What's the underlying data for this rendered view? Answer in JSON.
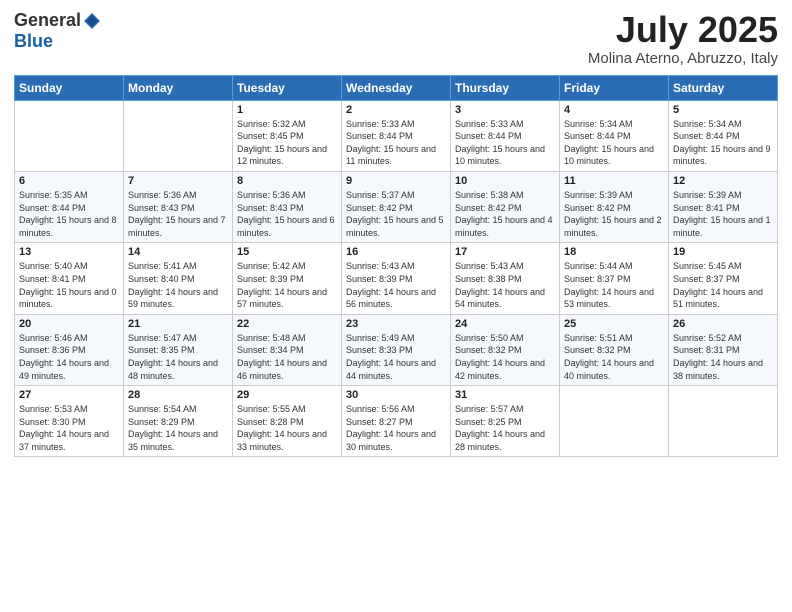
{
  "logo": {
    "general": "General",
    "blue": "Blue"
  },
  "title": "July 2025",
  "location": "Molina Aterno, Abruzzo, Italy",
  "weekdays": [
    "Sunday",
    "Monday",
    "Tuesday",
    "Wednesday",
    "Thursday",
    "Friday",
    "Saturday"
  ],
  "weeks": [
    [
      {
        "day": "",
        "info": ""
      },
      {
        "day": "",
        "info": ""
      },
      {
        "day": "1",
        "info": "Sunrise: 5:32 AM\nSunset: 8:45 PM\nDaylight: 15 hours and 12 minutes."
      },
      {
        "day": "2",
        "info": "Sunrise: 5:33 AM\nSunset: 8:44 PM\nDaylight: 15 hours and 11 minutes."
      },
      {
        "day": "3",
        "info": "Sunrise: 5:33 AM\nSunset: 8:44 PM\nDaylight: 15 hours and 10 minutes."
      },
      {
        "day": "4",
        "info": "Sunrise: 5:34 AM\nSunset: 8:44 PM\nDaylight: 15 hours and 10 minutes."
      },
      {
        "day": "5",
        "info": "Sunrise: 5:34 AM\nSunset: 8:44 PM\nDaylight: 15 hours and 9 minutes."
      }
    ],
    [
      {
        "day": "6",
        "info": "Sunrise: 5:35 AM\nSunset: 8:44 PM\nDaylight: 15 hours and 8 minutes."
      },
      {
        "day": "7",
        "info": "Sunrise: 5:36 AM\nSunset: 8:43 PM\nDaylight: 15 hours and 7 minutes."
      },
      {
        "day": "8",
        "info": "Sunrise: 5:36 AM\nSunset: 8:43 PM\nDaylight: 15 hours and 6 minutes."
      },
      {
        "day": "9",
        "info": "Sunrise: 5:37 AM\nSunset: 8:42 PM\nDaylight: 15 hours and 5 minutes."
      },
      {
        "day": "10",
        "info": "Sunrise: 5:38 AM\nSunset: 8:42 PM\nDaylight: 15 hours and 4 minutes."
      },
      {
        "day": "11",
        "info": "Sunrise: 5:39 AM\nSunset: 8:42 PM\nDaylight: 15 hours and 2 minutes."
      },
      {
        "day": "12",
        "info": "Sunrise: 5:39 AM\nSunset: 8:41 PM\nDaylight: 15 hours and 1 minute."
      }
    ],
    [
      {
        "day": "13",
        "info": "Sunrise: 5:40 AM\nSunset: 8:41 PM\nDaylight: 15 hours and 0 minutes."
      },
      {
        "day": "14",
        "info": "Sunrise: 5:41 AM\nSunset: 8:40 PM\nDaylight: 14 hours and 59 minutes."
      },
      {
        "day": "15",
        "info": "Sunrise: 5:42 AM\nSunset: 8:39 PM\nDaylight: 14 hours and 57 minutes."
      },
      {
        "day": "16",
        "info": "Sunrise: 5:43 AM\nSunset: 8:39 PM\nDaylight: 14 hours and 56 minutes."
      },
      {
        "day": "17",
        "info": "Sunrise: 5:43 AM\nSunset: 8:38 PM\nDaylight: 14 hours and 54 minutes."
      },
      {
        "day": "18",
        "info": "Sunrise: 5:44 AM\nSunset: 8:37 PM\nDaylight: 14 hours and 53 minutes."
      },
      {
        "day": "19",
        "info": "Sunrise: 5:45 AM\nSunset: 8:37 PM\nDaylight: 14 hours and 51 minutes."
      }
    ],
    [
      {
        "day": "20",
        "info": "Sunrise: 5:46 AM\nSunset: 8:36 PM\nDaylight: 14 hours and 49 minutes."
      },
      {
        "day": "21",
        "info": "Sunrise: 5:47 AM\nSunset: 8:35 PM\nDaylight: 14 hours and 48 minutes."
      },
      {
        "day": "22",
        "info": "Sunrise: 5:48 AM\nSunset: 8:34 PM\nDaylight: 14 hours and 46 minutes."
      },
      {
        "day": "23",
        "info": "Sunrise: 5:49 AM\nSunset: 8:33 PM\nDaylight: 14 hours and 44 minutes."
      },
      {
        "day": "24",
        "info": "Sunrise: 5:50 AM\nSunset: 8:32 PM\nDaylight: 14 hours and 42 minutes."
      },
      {
        "day": "25",
        "info": "Sunrise: 5:51 AM\nSunset: 8:32 PM\nDaylight: 14 hours and 40 minutes."
      },
      {
        "day": "26",
        "info": "Sunrise: 5:52 AM\nSunset: 8:31 PM\nDaylight: 14 hours and 38 minutes."
      }
    ],
    [
      {
        "day": "27",
        "info": "Sunrise: 5:53 AM\nSunset: 8:30 PM\nDaylight: 14 hours and 37 minutes."
      },
      {
        "day": "28",
        "info": "Sunrise: 5:54 AM\nSunset: 8:29 PM\nDaylight: 14 hours and 35 minutes."
      },
      {
        "day": "29",
        "info": "Sunrise: 5:55 AM\nSunset: 8:28 PM\nDaylight: 14 hours and 33 minutes."
      },
      {
        "day": "30",
        "info": "Sunrise: 5:56 AM\nSunset: 8:27 PM\nDaylight: 14 hours and 30 minutes."
      },
      {
        "day": "31",
        "info": "Sunrise: 5:57 AM\nSunset: 8:25 PM\nDaylight: 14 hours and 28 minutes."
      },
      {
        "day": "",
        "info": ""
      },
      {
        "day": "",
        "info": ""
      }
    ]
  ]
}
